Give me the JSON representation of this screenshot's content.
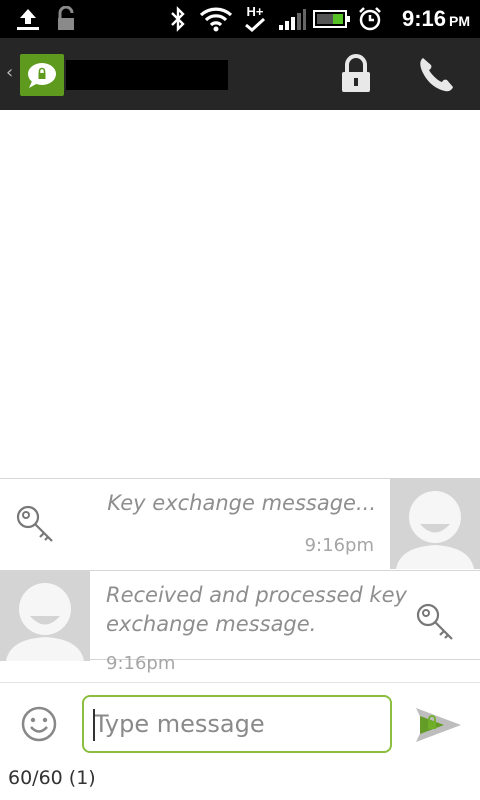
{
  "status_bar": {
    "time": "9:16",
    "ampm": "PM",
    "network_label": "H+",
    "icons": [
      "upload-icon",
      "unlock-icon",
      "bluetooth-icon",
      "wifi-icon",
      "signal-icon",
      "battery-icon",
      "alarm-icon"
    ]
  },
  "action_bar": {
    "app_icon": "secure-sms-icon",
    "contact_name": "",
    "actions": [
      "lock-icon",
      "phone-icon"
    ],
    "accent": "#5d9a1d"
  },
  "messages": [
    {
      "direction": "outgoing",
      "text": "Key exchange message...",
      "time": "9:16pm",
      "icon": "key-icon"
    },
    {
      "direction": "incoming",
      "text": "Received and processed key exchange message.",
      "time": "9:16pm",
      "icon": "key-icon"
    }
  ],
  "compose": {
    "placeholder": "Type message",
    "value": "",
    "counter": "60/60 (1)",
    "emoji_icon": "smiley-icon",
    "send_icon": "secure-send-icon",
    "border_color": "#8cbf3f"
  }
}
